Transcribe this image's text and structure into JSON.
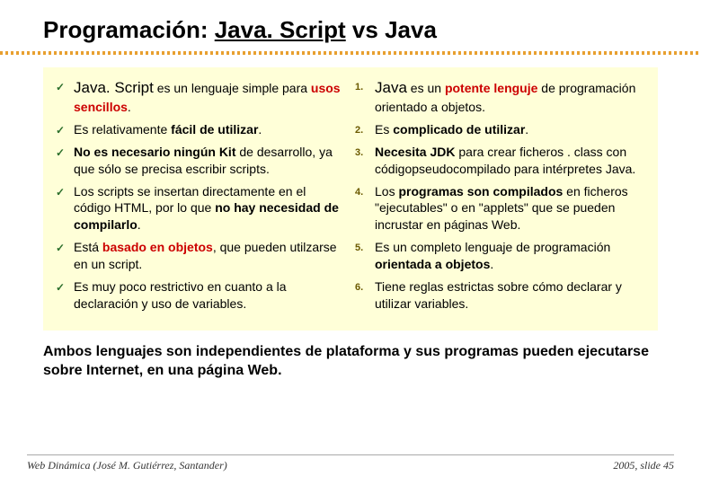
{
  "title": {
    "prefix": "Programación: ",
    "underlined": "Java. Script",
    "suffix": " vs Java"
  },
  "left": {
    "items": [
      {
        "lead": "Java. Script",
        "mid": " es un lenguaje simple para ",
        "red": "usos sencillos",
        "tail": "."
      },
      {
        "pre": "Es relativamente ",
        "bold": "fácil de utilizar",
        "tail": "."
      },
      {
        "bold1": "No es necesario ningún Kit",
        "mid": " de desarrollo, ya que sólo se precisa escribir scripts."
      },
      {
        "pre": "Los scripts se insertan directamente en el código HTML, por lo que ",
        "bold": "no hay necesidad de compilarlo",
        "tail": "."
      },
      {
        "pre": "Está ",
        "red": "basado en objetos",
        "tail": ", que pueden utilzarse en un script."
      },
      {
        "text": "Es muy poco restrictivo en cuanto a la declaración y uso de variables."
      }
    ]
  },
  "right": {
    "items": [
      {
        "num": "1.",
        "lead": "Java",
        "mid": " es un ",
        "red": "potente lenguje",
        "tail1": " de programación orientado a objetos."
      },
      {
        "num": "2.",
        "pre": "Es ",
        "bold": "complicado de utilizar",
        "tail": "."
      },
      {
        "num": "3.",
        "bold1": "Necesita JDK",
        "mid": " para crear ficheros . class con códigopseudocompilado para intérpretes Java."
      },
      {
        "num": "4.",
        "pre": "Los ",
        "bold": "programas son compilados",
        "tail": " en ficheros \"ejecutables\" o en \"applets\" que se pueden incrustar en páginas Web."
      },
      {
        "num": "5.",
        "pre": "Es un completo lenguaje de programación ",
        "bold": "orientada a objetos",
        "tail": "."
      },
      {
        "num": "6.",
        "text": "Tiene reglas estrictas sobre cómo declarar y utilizar variables."
      }
    ]
  },
  "bottom": "Ambos lenguajes son independientes de plataforma y sus programas pueden ejecutarse sobre Internet, en una página Web.",
  "footer": {
    "left": "Web Dinámica (José M. Gutiérrez, Santander)",
    "right": "2005, slide 45"
  }
}
